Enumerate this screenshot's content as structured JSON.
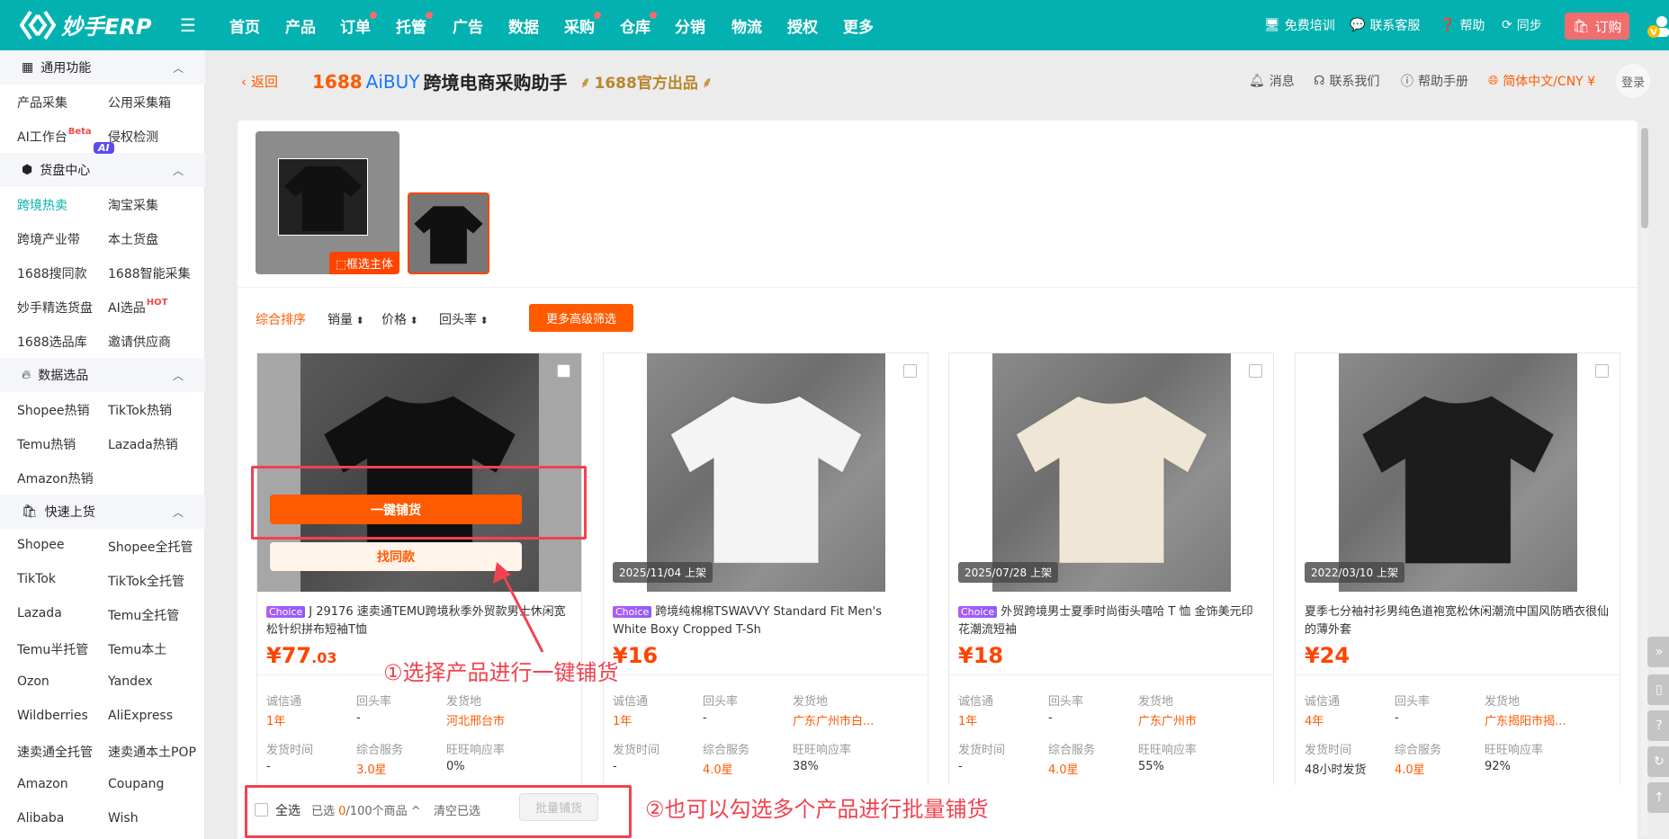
{
  "topbar": {
    "logo_text": "妙手ERP",
    "nav": [
      {
        "label": "首页",
        "dot": false
      },
      {
        "label": "产品",
        "dot": false
      },
      {
        "label": "订单",
        "dot": true
      },
      {
        "label": "托管",
        "dot": true
      },
      {
        "label": "广告",
        "dot": false
      },
      {
        "label": "数据",
        "dot": false
      },
      {
        "label": "采购",
        "dot": true
      },
      {
        "label": "仓库",
        "dot": true
      },
      {
        "label": "分销",
        "dot": false
      },
      {
        "label": "物流",
        "dot": false
      },
      {
        "label": "授权",
        "dot": false
      },
      {
        "label": "更多",
        "dot": false
      }
    ],
    "free_training": "免费培训",
    "customer_service": "联系客服",
    "help": "帮助",
    "sync": "同步",
    "order": "订购",
    "avatar_badge": "V"
  },
  "sidebar": {
    "sections": [
      {
        "title": "通用功能",
        "icon": "grid-icon",
        "items": [
          {
            "label": "产品采集"
          },
          {
            "label": "公用采集箱"
          },
          {
            "label": "AI工作台",
            "sup": "Beta"
          },
          {
            "label": "侵权检测"
          }
        ]
      },
      {
        "title": "货盘中心",
        "icon": "cube-icon",
        "badge": "AI",
        "items": [
          {
            "label": "跨境热卖",
            "active": true
          },
          {
            "label": "淘宝采集"
          },
          {
            "label": "跨境产业带"
          },
          {
            "label": "本土货盘"
          },
          {
            "label": "1688搜同款"
          },
          {
            "label": "1688智能采集"
          },
          {
            "label": "妙手精选货盘"
          },
          {
            "label": "AI选品",
            "sup": "HOT"
          },
          {
            "label": "1688选品库"
          },
          {
            "label": "邀请供应商"
          }
        ]
      },
      {
        "title": "数据选品",
        "icon": "fire-icon",
        "items": [
          {
            "label": "Shopee热销"
          },
          {
            "label": "TikTok热销"
          },
          {
            "label": "Temu热销"
          },
          {
            "label": "Lazada热销"
          },
          {
            "label": "Amazon热销"
          }
        ]
      },
      {
        "title": "快速上货",
        "icon": "bag-icon",
        "items": [
          {
            "label": "Shopee"
          },
          {
            "label": "Shopee全托管"
          },
          {
            "label": "TikTok"
          },
          {
            "label": "TikTok全托管"
          },
          {
            "label": "Lazada"
          },
          {
            "label": "Temu全托管"
          },
          {
            "label": "Temu半托管"
          },
          {
            "label": "Temu本土"
          },
          {
            "label": "Ozon"
          },
          {
            "label": "Yandex"
          },
          {
            "label": "Wildberries"
          },
          {
            "label": "AliExpress"
          },
          {
            "label": "速卖通全托管"
          },
          {
            "label": "速卖通本土POP"
          },
          {
            "label": "Amazon"
          },
          {
            "label": "Coupang"
          },
          {
            "label": "Alibaba"
          },
          {
            "label": "Wish"
          }
        ]
      }
    ]
  },
  "header": {
    "back": "返回",
    "brand_1688": "1688",
    "brand_aibuy": "AiBUY",
    "brand_title": "跨境电商采购助手",
    "official": "1688官方出品",
    "messages": "消息",
    "contact_us": "联系我们",
    "help_manual": "帮助手册",
    "language": "简体中文/CNY ¥",
    "login": "登录"
  },
  "image_search": {
    "select_subject": "框选主体"
  },
  "sort": {
    "items": [
      "综合排序",
      "销量",
      "价格",
      "回头率"
    ],
    "advanced_filter": "更多高级筛选"
  },
  "stat_labels": [
    "诚信通",
    "回头率",
    "发货地",
    "发货时间",
    "综合服务",
    "旺旺响应率"
  ],
  "hover_actions": {
    "one_click": "一键铺货",
    "find_same": "找同款"
  },
  "products": [
    {
      "choice": "Choice",
      "title": "J 29176 速卖通TEMU跨境秋季外贸款男士休闲宽松针织拼布短袖T恤",
      "price_int": "¥77",
      "price_dec": ".03",
      "date": "",
      "shirt": "#1a1a1a",
      "stats": [
        "1年",
        "-",
        "河北邢台市",
        "-",
        "3.0星",
        "0%"
      ]
    },
    {
      "choice": "Choice",
      "title": "跨境纯棉棉TSWAVVY Standard Fit Men's White Boxy Cropped T-Sh",
      "price_int": "¥16",
      "price_dec": "",
      "date": "2025/11/04 上架",
      "shirt": "#f4f4f4",
      "stats": [
        "1年",
        "-",
        "广东广州市白...",
        "-",
        "4.0星",
        "38%"
      ]
    },
    {
      "choice": "Choice",
      "title": "外贸跨境男士夏季时尚街头嘻哈 T 恤 金饰美元印花潮流短袖",
      "price_int": "¥18",
      "price_dec": "",
      "date": "2025/07/28 上架",
      "shirt": "#efe6d6",
      "stats": [
        "1年",
        "-",
        "广东广州市",
        "-",
        "4.0星",
        "55%"
      ]
    },
    {
      "choice": "",
      "title": "夏季七分袖衬衫男纯色道袍宽松休闲潮流中国风防晒衣很仙的薄外套",
      "price_int": "¥24",
      "price_dec": "",
      "date": "2022/03/10 上架",
      "shirt": "#1c1c1c",
      "stats": [
        "4年",
        "-",
        "广东揭阳市揭...",
        "48小时发货",
        "4.0星",
        "92%"
      ]
    }
  ],
  "bulk": {
    "select_all": "全选",
    "selected_prefix": "已选 ",
    "selected_count": "0",
    "selected_suffix": "/100个商品",
    "clear": "清空已选",
    "bulk_list": "批量铺货"
  },
  "annotations": {
    "step1": "①选择产品进行一键铺货",
    "step2": "②也可以勾选多个产品进行批量铺货"
  },
  "colors": {
    "brand": "#03b2b0",
    "accent": "#ff5a00",
    "annotation": "#f0434f"
  }
}
